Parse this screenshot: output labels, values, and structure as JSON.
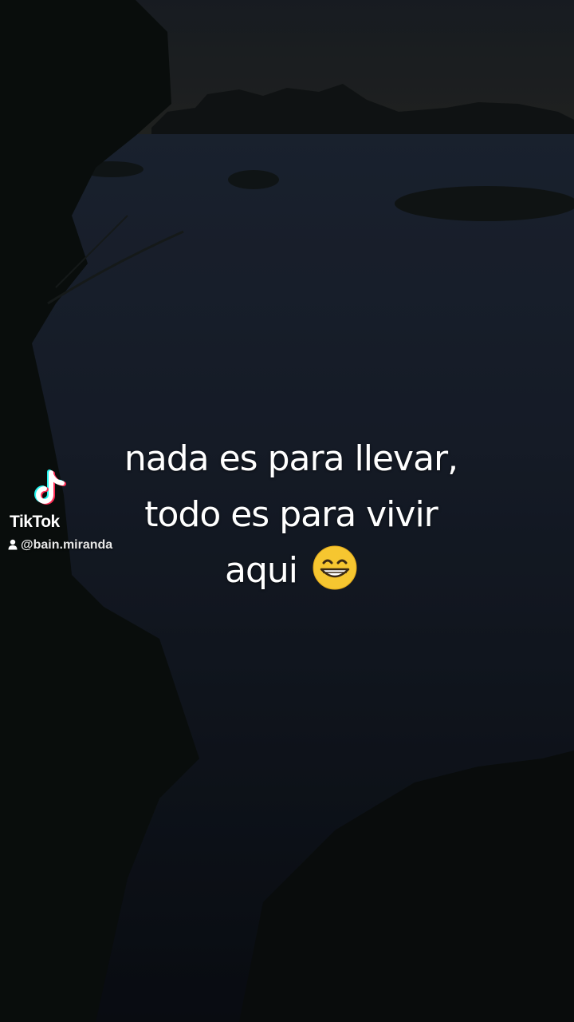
{
  "caption": {
    "lines": [
      "nada es para llevar,",
      "todo es para vivir",
      "aqui"
    ],
    "emoji_icon": "grinning-face-emoji"
  },
  "watermark": {
    "app_name": "TikTok",
    "username": "@bain.miranda",
    "logo_icon": "tiktok-logo-icon",
    "user_icon": "person-icon"
  },
  "colors": {
    "text": "#ffffff",
    "tiktok_cyan": "#25f4ee",
    "tiktok_red": "#fe2c55",
    "background_dark": "#0f141d"
  }
}
